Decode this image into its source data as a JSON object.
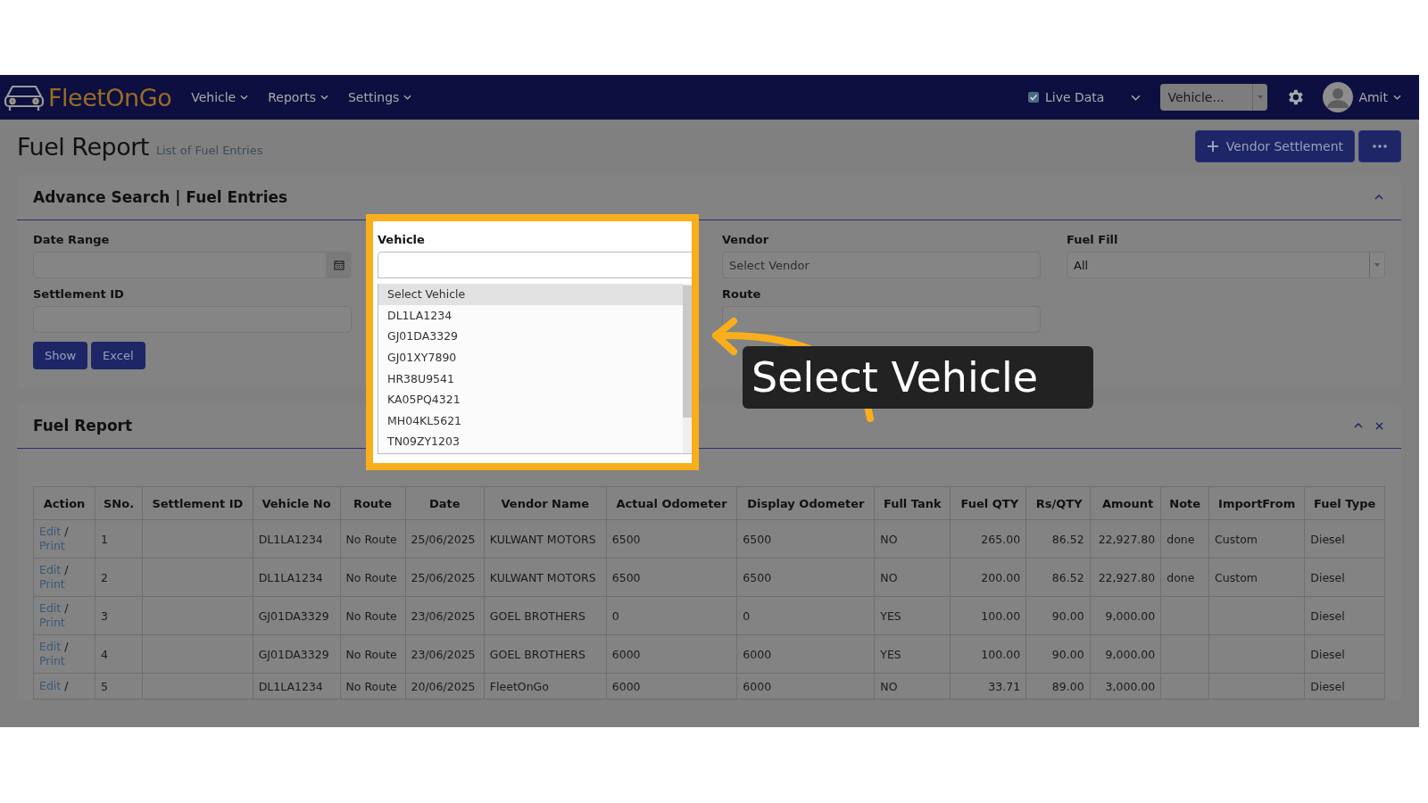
{
  "navbar": {
    "logo": "FleetOnGo",
    "menu": [
      {
        "label": "Vehicle"
      },
      {
        "label": "Reports"
      },
      {
        "label": "Settings"
      }
    ],
    "live_data": {
      "label": "Live Data",
      "checked": true
    },
    "vehicle_select": {
      "value": "Vehicle..."
    },
    "user": {
      "name": "Amit"
    }
  },
  "page_header": {
    "title": "Fuel Report",
    "subtitle": "List of Fuel Entries",
    "primary_button": "Vendor Settlement"
  },
  "search": {
    "title": "Advance Search | Fuel Entries",
    "fields": [
      {
        "kind": "date",
        "label": "Date Range"
      },
      {
        "kind": "dropdown",
        "label": "Vehicle",
        "options": [
          {
            "label": "Select Vehicle",
            "selected": true
          },
          {
            "label": "DL1LA1234",
            "selected": false
          },
          {
            "label": "GJ01DA3329",
            "selected": false
          },
          {
            "label": "GJ01XY7890",
            "selected": false
          },
          {
            "label": "HR38U9541",
            "selected": false
          },
          {
            "label": "KA05PQ4321",
            "selected": false
          },
          {
            "label": "MH04KL5621",
            "selected": false
          },
          {
            "label": "TN09ZY1203",
            "selected": false
          }
        ]
      },
      {
        "kind": "text",
        "label": "Vendor",
        "placeholder": "Select Vendor"
      },
      {
        "kind": "select",
        "label": "Fuel Fill",
        "value": "All"
      },
      {
        "kind": "text",
        "label": "Settlement ID"
      },
      {
        "kind": "text",
        "label": "Route"
      }
    ],
    "buttons": [
      "Show",
      "Excel"
    ]
  },
  "report": {
    "title": "Fuel Report",
    "table": {
      "columns": [
        {
          "label": "SNo.",
          "numeric": false
        },
        {
          "label": "Settlement ID",
          "numeric": false
        },
        {
          "label": "Vehicle No",
          "numeric": false
        },
        {
          "label": "Route",
          "numeric": false
        },
        {
          "label": "Date",
          "numeric": false
        },
        {
          "label": "Vendor Name",
          "numeric": false
        },
        {
          "label": "Actual Odometer",
          "numeric": false
        },
        {
          "label": "Display Odometer",
          "numeric": false
        },
        {
          "label": "Full Tank",
          "numeric": false
        },
        {
          "label": "Fuel QTY",
          "numeric": true
        },
        {
          "label": "Rs/QTY",
          "numeric": true
        },
        {
          "label": "Amount",
          "numeric": true
        },
        {
          "label": "Note",
          "numeric": false
        },
        {
          "label": "ImportFrom",
          "numeric": false
        },
        {
          "label": "Fuel Type",
          "numeric": false
        }
      ],
      "action_column": "Action",
      "rows": [
        {
          "actions": [
            {
              "kind": "link",
              "text": "Edit"
            },
            {
              "kind": "separator",
              "text": "/"
            },
            {
              "kind": "link",
              "text": "Print"
            }
          ],
          "cells": [
            "1",
            "",
            "DL1LA1234",
            "No Route",
            "25/06/2025",
            "KULWANT MOTORS",
            "6500",
            "6500",
            "NO",
            "265.00",
            "86.52",
            "22,927.80",
            "done",
            "Custom",
            "Diesel"
          ]
        },
        {
          "actions": [
            {
              "kind": "link",
              "text": "Edit"
            },
            {
              "kind": "separator",
              "text": "/"
            },
            {
              "kind": "link",
              "text": "Print"
            }
          ],
          "cells": [
            "2",
            "",
            "DL1LA1234",
            "No Route",
            "25/06/2025",
            "KULWANT MOTORS",
            "6500",
            "6500",
            "NO",
            "200.00",
            "86.52",
            "22,927.80",
            "done",
            "Custom",
            "Diesel"
          ]
        },
        {
          "actions": [
            {
              "kind": "link",
              "text": "Edit"
            },
            {
              "kind": "separator",
              "text": "/"
            },
            {
              "kind": "link",
              "text": "Print"
            }
          ],
          "cells": [
            "3",
            "",
            "GJ01DA3329",
            "No Route",
            "23/06/2025",
            "GOEL BROTHERS",
            "0",
            "0",
            "YES",
            "100.00",
            "90.00",
            "9,000.00",
            "",
            "",
            "Diesel"
          ]
        },
        {
          "actions": [
            {
              "kind": "link",
              "text": "Edit"
            },
            {
              "kind": "separator",
              "text": "/"
            },
            {
              "kind": "link",
              "text": "Print"
            }
          ],
          "cells": [
            "4",
            "",
            "GJ01DA3329",
            "No Route",
            "23/06/2025",
            "GOEL BROTHERS",
            "6000",
            "6000",
            "YES",
            "100.00",
            "90.00",
            "9,000.00",
            "",
            "",
            "Diesel"
          ]
        },
        {
          "actions": [
            {
              "kind": "link",
              "text": "Edit"
            },
            {
              "kind": "separator",
              "text": "/"
            }
          ],
          "cells": [
            "5",
            "",
            "DL1LA1234",
            "No Route",
            "20/06/2025",
            "FleetOnGo",
            "6000",
            "6000",
            "NO",
            "33.71",
            "89.00",
            "3,000.00",
            "",
            "",
            "Diesel"
          ]
        }
      ]
    }
  },
  "callout": {
    "text": "Select Vehicle"
  }
}
